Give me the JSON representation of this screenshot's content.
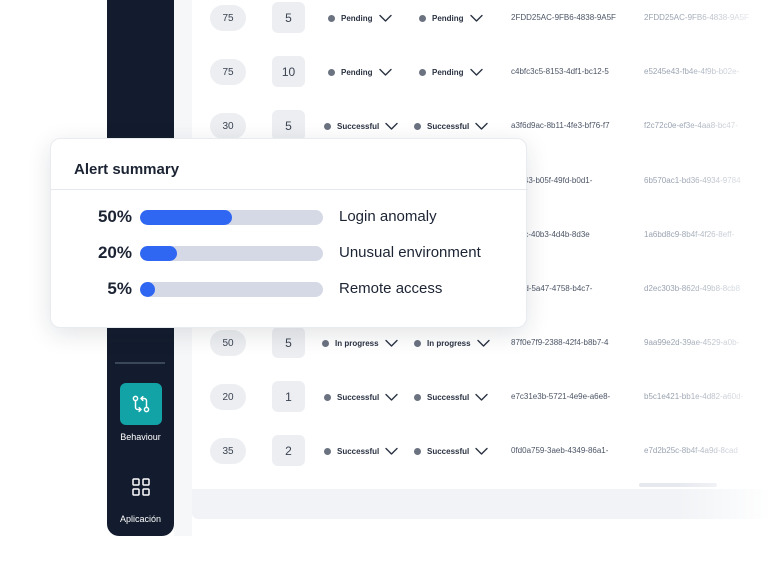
{
  "sidebar": {
    "items": [
      {
        "label": "Behaviour",
        "icon": "git-compare-icon",
        "active": true
      },
      {
        "label": "Aplicación",
        "icon": "grid-icon",
        "active": false
      }
    ],
    "active_color": "#11a3a6",
    "background": "#131c2e"
  },
  "table": {
    "rows": [
      {
        "score": "75",
        "count": "5",
        "status_a": "Pending",
        "status_b": "Pending",
        "id_a": "2FDD25AC-9FB6-4838-9A5F",
        "id_b": "2FDD25AC-9FB6-4838-9A5F"
      },
      {
        "score": "75",
        "count": "10",
        "status_a": "Pending",
        "status_b": "Pending",
        "id_a": "c4bfc3c5-8153-4df1-bc12-5",
        "id_b": "e5245e43-fb4e-4f9b-b02e-"
      },
      {
        "score": "30",
        "count": "5",
        "status_a": "Successful",
        "status_b": "Successful",
        "id_a": "a3f6d9ac-8b11-4fe3-bf76-f7",
        "id_b": "f2c72c0e-ef3e-4aa8-bc47-"
      },
      {
        "score": "",
        "count": "",
        "status_a": "",
        "status_b": "",
        "id_a": "c9643-b05f-49fd-b0d1-",
        "id_b": "6b570ac1-bd36-4934-9784"
      },
      {
        "score": "",
        "count": "",
        "status_a": "",
        "status_b": "",
        "id_a": "3a3c-40b3-4d4b-8d3e",
        "id_b": "1a6bd8c9-8b4f-4f26-8eff-"
      },
      {
        "score": "",
        "count": "",
        "status_a": "",
        "status_b": "",
        "id_a": "662d-5a47-4758-b4c7-",
        "id_b": "d2ec303b-862d-49b8-8cb8"
      },
      {
        "score": "50",
        "count": "5",
        "status_a": "In progress",
        "status_b": "In progress",
        "id_a": "87f0e7f9-2388-42f4-b8b7-4",
        "id_b": "9aa99e2d-39ae-4529-a0b-"
      },
      {
        "score": "20",
        "count": "1",
        "status_a": "Successful",
        "status_b": "Successful",
        "id_a": "e7c31e3b-5721-4e9e-a6e8-",
        "id_b": "b5c1e421-bb1e-4d82-a60d-"
      },
      {
        "score": "35",
        "count": "2",
        "status_a": "Successful",
        "status_b": "Successful",
        "id_a": "0fd0a759-3aeb-4349-86a1-",
        "id_b": "e7d2b25c-8b4f-4a9d-8cad"
      }
    ]
  },
  "alert_summary": {
    "title": "Alert summary",
    "bar_color": "#2f66f2",
    "items": [
      {
        "percent": "50%",
        "value": 0.5,
        "label": "Login anomaly"
      },
      {
        "percent": "20%",
        "value": 0.2,
        "label": "Unusual environment"
      },
      {
        "percent": "5%",
        "value": 0.05,
        "label": "Remote access"
      }
    ]
  }
}
